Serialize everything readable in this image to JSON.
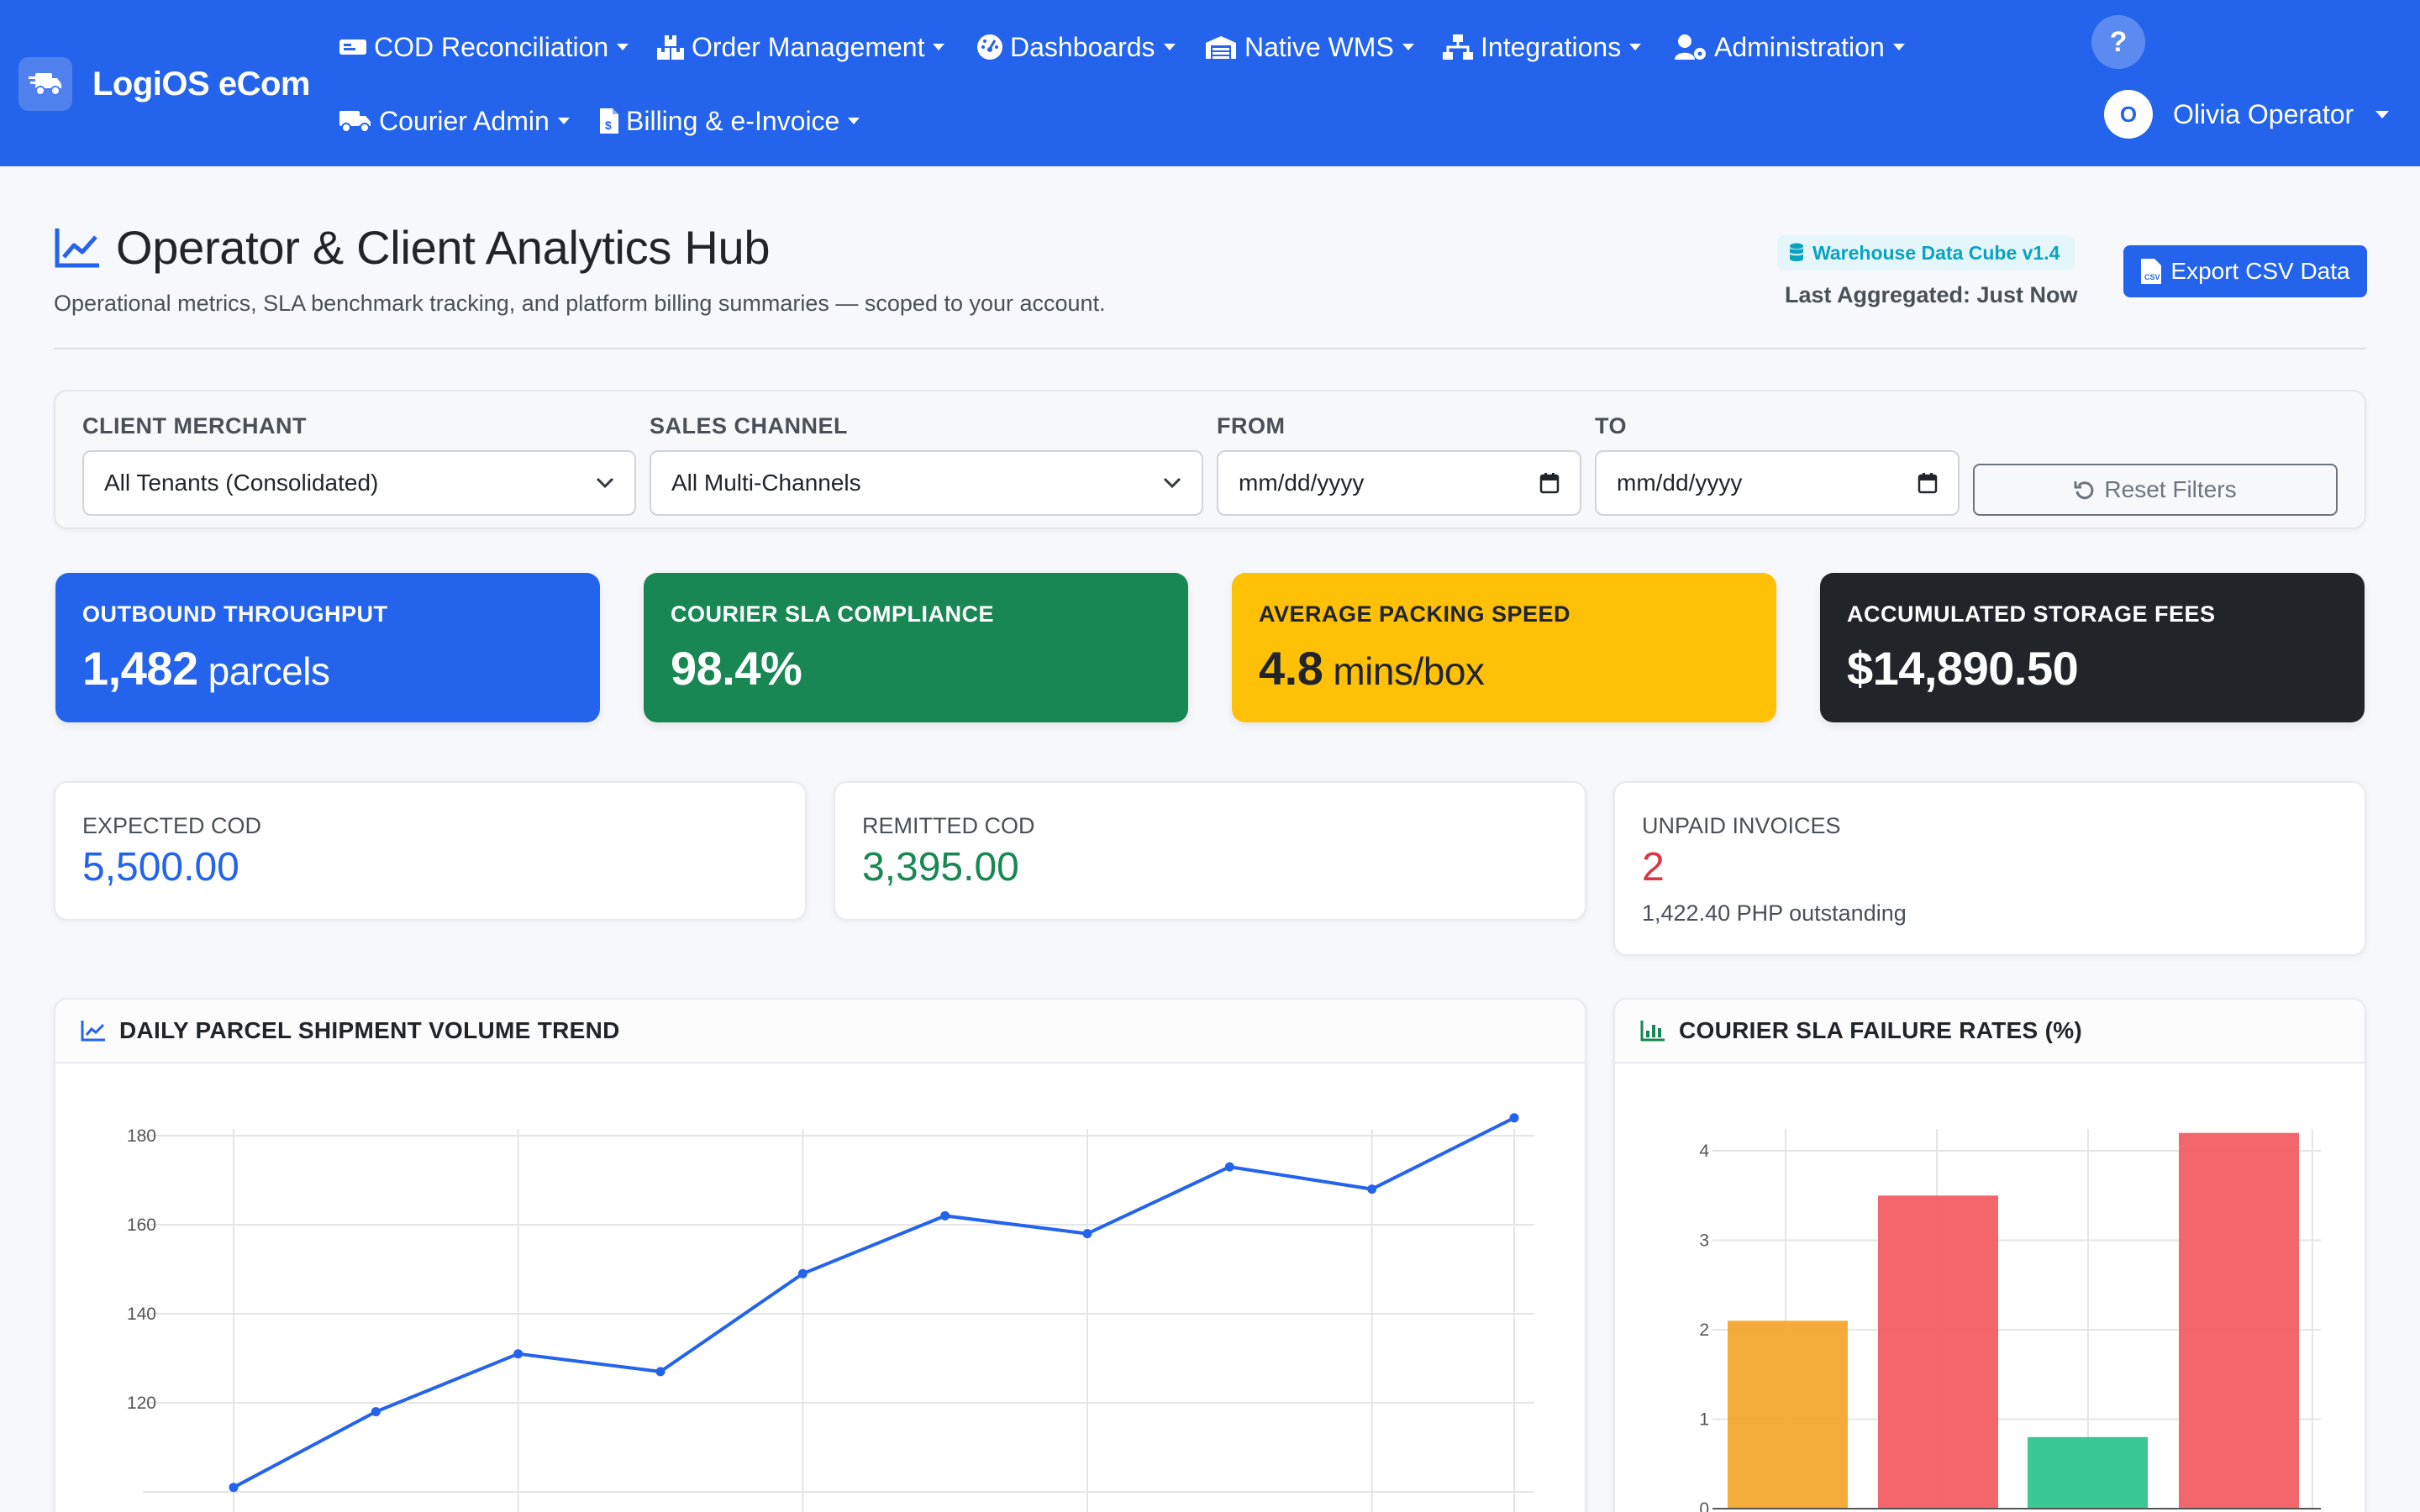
{
  "app": {
    "brand": "LogiOS eCom"
  },
  "nav": {
    "items": [
      {
        "label": "COD Reconciliation",
        "icon": "money-bill-icon"
      },
      {
        "label": "Order Management",
        "icon": "boxes-icon"
      },
      {
        "label": "Dashboards",
        "icon": "gauge-icon"
      },
      {
        "label": "Native WMS",
        "icon": "warehouse-icon"
      },
      {
        "label": "Integrations",
        "icon": "sitemap-icon"
      },
      {
        "label": "Administration",
        "icon": "user-gear-icon"
      },
      {
        "label": "Courier Admin",
        "icon": "truck-icon"
      },
      {
        "label": "Billing & e-Invoice",
        "icon": "invoice-icon"
      }
    ],
    "help": "?",
    "user": {
      "initial": "O",
      "name": "Olivia Operator"
    }
  },
  "header": {
    "title": "Operator & Client Analytics Hub",
    "subtitle": "Operational metrics, SLA benchmark tracking, and platform billing summaries — scoped to your account.",
    "badge": "Warehouse Data Cube v1.4",
    "last_aggregated": "Last Aggregated: Just Now",
    "export_label": "Export CSV Data"
  },
  "filters": {
    "merchant": {
      "label": "CLIENT MERCHANT",
      "value": "All Tenants (Consolidated)"
    },
    "channel": {
      "label": "SALES CHANNEL",
      "value": "All Multi-Channels"
    },
    "from": {
      "label": "FROM",
      "placeholder": "mm/dd/yyyy"
    },
    "to": {
      "label": "TO",
      "placeholder": "mm/dd/yyyy"
    },
    "reset_label": "Reset Filters"
  },
  "kpis": [
    {
      "label": "OUTBOUND THROUGHPUT",
      "value": "1,482",
      "unit": "parcels",
      "bg": "#2463eb",
      "fg": "#ffffff"
    },
    {
      "label": "COURIER SLA COMPLIANCE",
      "value": "98.4%",
      "unit": "",
      "bg": "#198754",
      "fg": "#ffffff"
    },
    {
      "label": "AVERAGE PACKING SPEED",
      "value": "4.8",
      "unit": "mins/box",
      "bg": "#ffc107",
      "fg": "#212529"
    },
    {
      "label": "ACCUMULATED STORAGE FEES",
      "value": "$14,890.50",
      "unit": "",
      "bg": "#212529",
      "fg": "#ffffff"
    }
  ],
  "summary": {
    "expected": {
      "label": "EXPECTED COD",
      "value": "5,500.00",
      "color": "#2463eb"
    },
    "remitted": {
      "label": "REMITTED COD",
      "value": "3,395.00",
      "color": "#198754"
    },
    "unpaid": {
      "label": "UNPAID INVOICES",
      "value": "2",
      "note": "1,422.40 PHP outstanding",
      "color": "#dc3545"
    }
  },
  "charts": {
    "volume_title": "DAILY PARCEL SHIPMENT VOLUME TREND",
    "sla_title": "COURIER SLA FAILURE RATES (%)"
  },
  "chart_data": [
    {
      "type": "line",
      "title": "DAILY PARCEL SHIPMENT VOLUME TREND",
      "xlabel": "",
      "ylabel": "",
      "y_ticks": [
        120,
        140,
        160,
        180
      ],
      "series": [
        {
          "values": [
            101,
            118,
            131,
            127,
            149,
            162,
            158,
            173,
            168,
            184
          ],
          "color": "#2463eb"
        }
      ]
    },
    {
      "type": "bar",
      "title": "COURIER SLA FAILURE RATES (%)",
      "xlabel": "",
      "ylabel": "",
      "y_ticks": [
        0,
        1,
        2,
        3,
        4
      ],
      "values": [
        2.1,
        3.5,
        0.8,
        4.2
      ],
      "colors": [
        "#f4a72e",
        "#f25f64",
        "#2fc58f",
        "#f25f64"
      ]
    }
  ]
}
